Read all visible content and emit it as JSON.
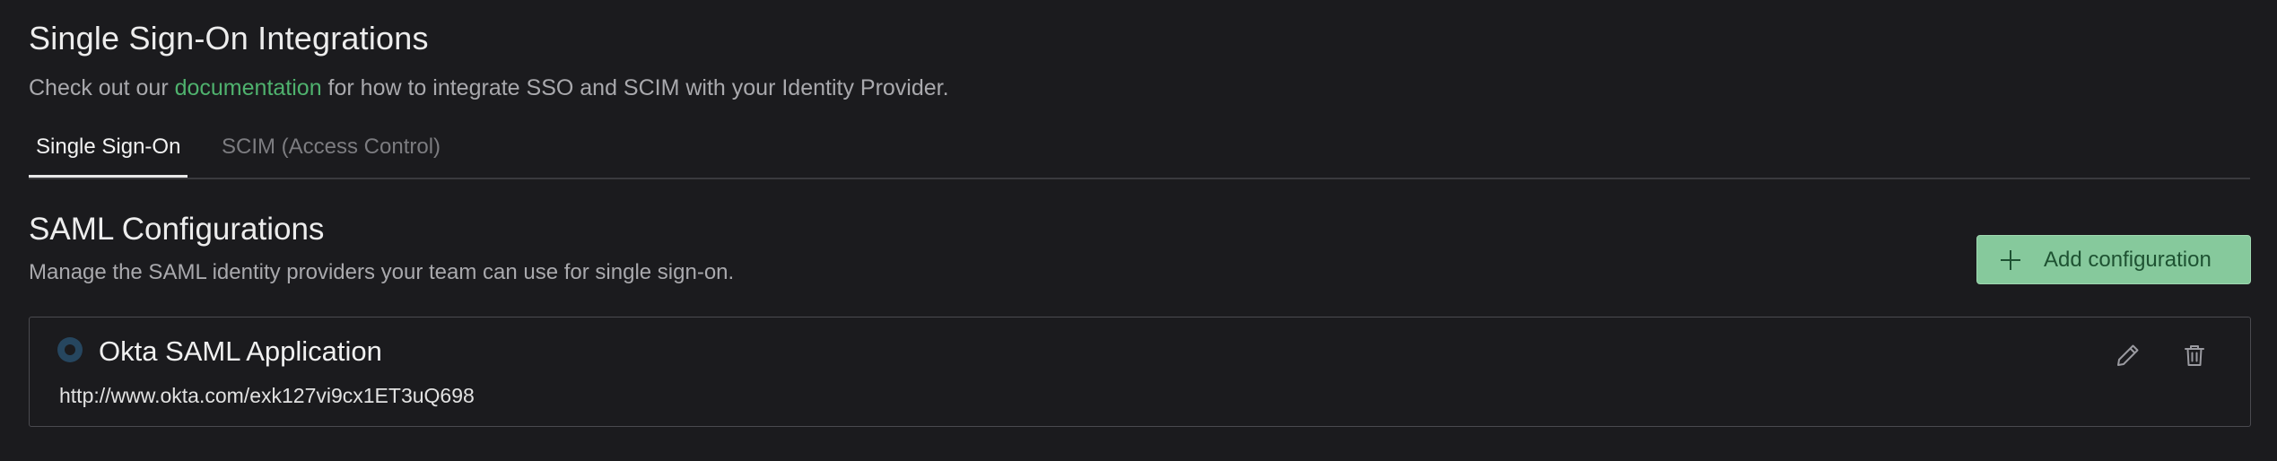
{
  "header": {
    "title": "Single Sign-On Integrations",
    "subtitle_prefix": "Check out our ",
    "subtitle_link": "documentation",
    "subtitle_suffix": " for how to integrate SSO and SCIM with your Identity Provider."
  },
  "tabs": [
    {
      "label": "Single Sign-On",
      "active": true
    },
    {
      "label": "SCIM (Access Control)",
      "active": false
    }
  ],
  "section": {
    "title": "SAML Configurations",
    "description": "Manage the SAML identity providers your team can use for single sign-on.",
    "add_button_label": "Add configuration",
    "add_button_icon": "plus-icon"
  },
  "configurations": [
    {
      "name": "Okta SAML Application",
      "url": "http://www.okta.com/exk127vi9cx1ET3uQ698",
      "status_icon": "status-ring-icon",
      "edit_icon": "pencil-icon",
      "delete_icon": "trash-icon"
    }
  ],
  "colors": {
    "background": "#1b1b1e",
    "link": "#4fb26e",
    "primary_button": "#86c99c",
    "primary_button_text": "#1e5232",
    "status_ring": "#26465f"
  }
}
